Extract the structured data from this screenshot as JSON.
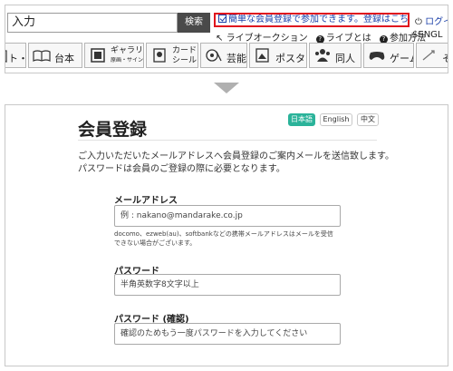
{
  "header": {
    "search_value": "入力",
    "search_button": "検索",
    "register_link": "簡単な会員登録で参加できます。登録はこちら",
    "login_link": "ログイ",
    "sub_links": [
      "ライブオークション",
      "ライブとは",
      "参加方法"
    ],
    "english_link": "ENGL",
    "categories": [
      {
        "label": "ト・本",
        "icon": "book-icon"
      },
      {
        "label": "台本",
        "icon": "script-book-icon"
      },
      {
        "label": "ギャラリー",
        "sub": "原画・サイン本",
        "icon": "gallery-frame-icon"
      },
      {
        "label": "カード",
        "sub": "シール",
        "icon": "card-icon"
      },
      {
        "label": "芸能",
        "icon": "cd-icon"
      },
      {
        "label": "ポスター",
        "icon": "poster-icon"
      },
      {
        "label": "同人",
        "icon": "people-icon"
      },
      {
        "label": "ゲーム",
        "icon": "gamepad-icon"
      },
      {
        "label": "その",
        "icon": "other-icon"
      }
    ]
  },
  "form": {
    "title": "会員登録",
    "languages": [
      {
        "label": "日本語",
        "active": true
      },
      {
        "label": "English",
        "active": false
      },
      {
        "label": "中文",
        "active": false
      }
    ],
    "intro_line1": "ご入力いただいたメールアドレスへ会員登録のご案内メールを送信致します。",
    "intro_line2": "パスワードは会員のご登録の際に必要となります。",
    "email_label": "メールアドレス",
    "email_placeholder": "例 : nakano@mandarake.co.jp",
    "email_note_line1": "docomo、ezweb(au)、softbankなどの携帯メールアドレスはメールを受信",
    "email_note_line2": "できない場合がございます。",
    "password_label": "パスワード",
    "password_placeholder": "半角英数字8文字以上",
    "confirm_label": "パスワード (確認)",
    "confirm_placeholder": "確認のためもう一度パスワードを入力してください"
  }
}
